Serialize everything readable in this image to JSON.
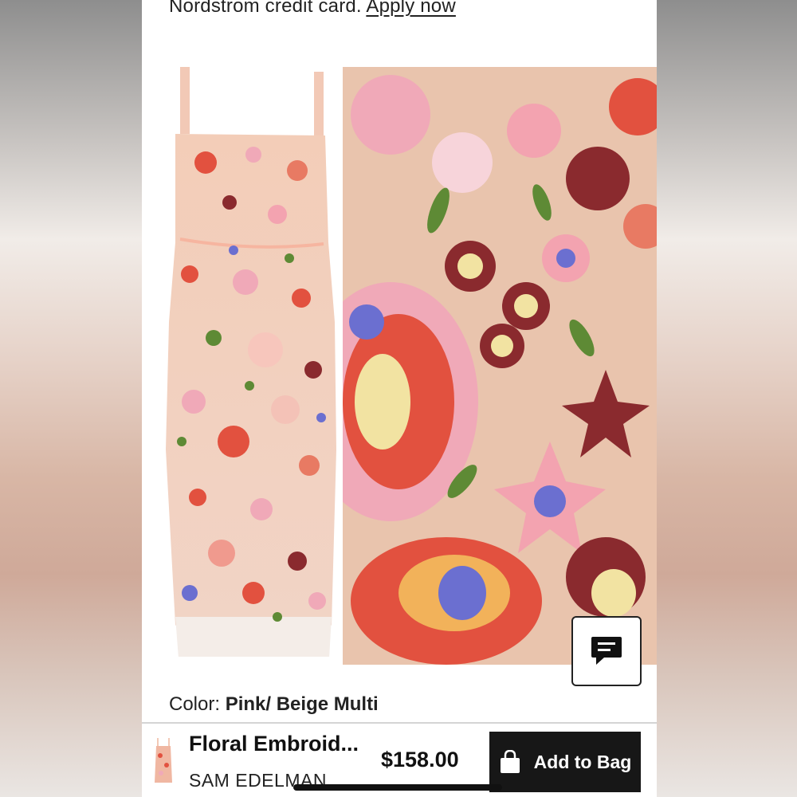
{
  "promo": {
    "text": "Nordstrom credit card.",
    "link": "Apply now"
  },
  "color": {
    "label": "Color:",
    "value": "Pink/ Beige Multi"
  },
  "bottom_bar": {
    "product_name": "Floral Embroid...",
    "brand": "SAM EDELMAN",
    "price": "$158.00",
    "add_to_bag": "Add to Bag"
  },
  "icons": {
    "chat": "chat-bubble-icon",
    "bag": "shopping-bag-icon"
  },
  "colors": {
    "background": "#ffffff",
    "button": "#171717",
    "fabric_base": "#e9c4ad",
    "embroidery_red": "#e2513f",
    "embroidery_pink": "#f0a9b8",
    "embroidery_green": "#5e8a35",
    "embroidery_maroon": "#8a2a2e",
    "embroidery_blue": "#6b6fd0",
    "embroidery_yellow": "#f2e3a2"
  }
}
